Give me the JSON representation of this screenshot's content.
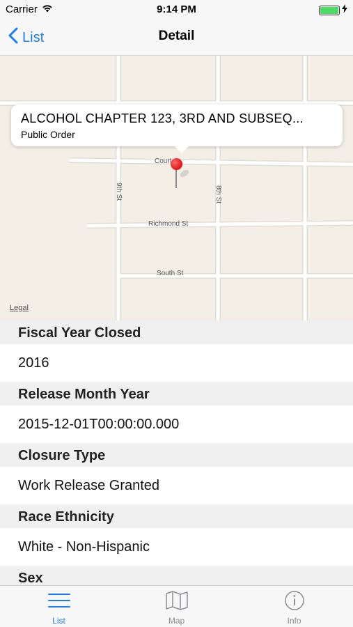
{
  "status_bar": {
    "carrier": "Carrier",
    "time": "9:14 PM",
    "battery_level": 1.0,
    "battery_color": "#4cd964"
  },
  "nav": {
    "back_label": "List",
    "title": "Detail",
    "accent_color": "#1a7cf5"
  },
  "map": {
    "callout_title": "ALCOHOL CHAPTER 123, 3RD AND SUBSEQ...",
    "callout_subtitle": "Public Order",
    "legal_label": "Legal",
    "street_labels": {
      "court": "Court",
      "ninth": "9th St",
      "eighth": "8th St",
      "richmond": "Richmond St",
      "south": "South St"
    },
    "pin_color": "#e01010"
  },
  "details": [
    {
      "label": "Fiscal Year Closed",
      "value": "2016"
    },
    {
      "label": "Release Month Year",
      "value": "2015-12-01T00:00:00.000"
    },
    {
      "label": "Closure Type",
      "value": "Work Release Granted"
    },
    {
      "label": "Race Ethnicity",
      "value": "White - Non-Hispanic"
    },
    {
      "label": "Sex",
      "value": ""
    }
  ],
  "tabs": [
    {
      "label": "List",
      "icon": "list-icon",
      "active": true
    },
    {
      "label": "Map",
      "icon": "map-icon",
      "active": false
    },
    {
      "label": "Info",
      "icon": "info-icon",
      "active": false
    }
  ]
}
